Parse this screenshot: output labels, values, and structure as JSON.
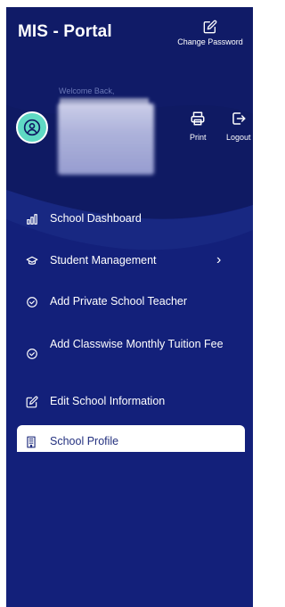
{
  "header": {
    "title": "MIS - Portal",
    "change_password_label": "Change Password"
  },
  "user": {
    "welcome": "Welcome Back,",
    "print_label": "Print",
    "logout_label": "Logout"
  },
  "menu": {
    "items": [
      {
        "label": "School Dashboard",
        "icon": "bar-chart-icon"
      },
      {
        "label": "Student Management",
        "icon": "graduation-cap-icon",
        "has_submenu": true,
        "chevron": "›"
      },
      {
        "label": "Add Private School Teacher",
        "icon": "check-circle-icon"
      },
      {
        "label": "Add Classwise Monthly Tuition Fee",
        "icon": "check-circle-icon"
      },
      {
        "label": "Edit School Information",
        "icon": "edit-icon"
      },
      {
        "label": "School Profile",
        "icon": "building-icon",
        "active": true
      }
    ]
  },
  "colors": {
    "sidebar_bg": "#0f1a63",
    "wave": "#1a2a85",
    "avatar": "#5fd9c4",
    "active_text": "#23307f"
  }
}
